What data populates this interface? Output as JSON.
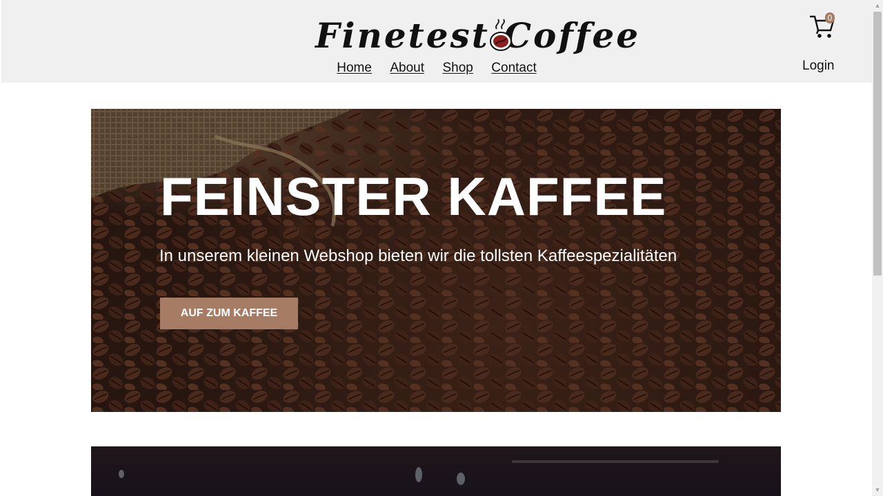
{
  "header": {
    "logo_text": "Finetest Coffee",
    "nav": [
      "Home",
      "About",
      "Shop",
      "Contact"
    ],
    "cart_count": "0",
    "login_label": "Login"
  },
  "hero": {
    "title": "FEINSTER KAFFEE",
    "subtitle": "In unserem kleinen Webshop bieten wir die tollsten Kaffeespezialitäten",
    "button_label": "AUF ZUM KAFFEE"
  },
  "colors": {
    "accent": "#a67c64",
    "header_bg": "#f0f0f0",
    "hero_dark": "#2e1a13"
  },
  "icons": [
    "cart-icon",
    "coffee-bean-icon"
  ]
}
